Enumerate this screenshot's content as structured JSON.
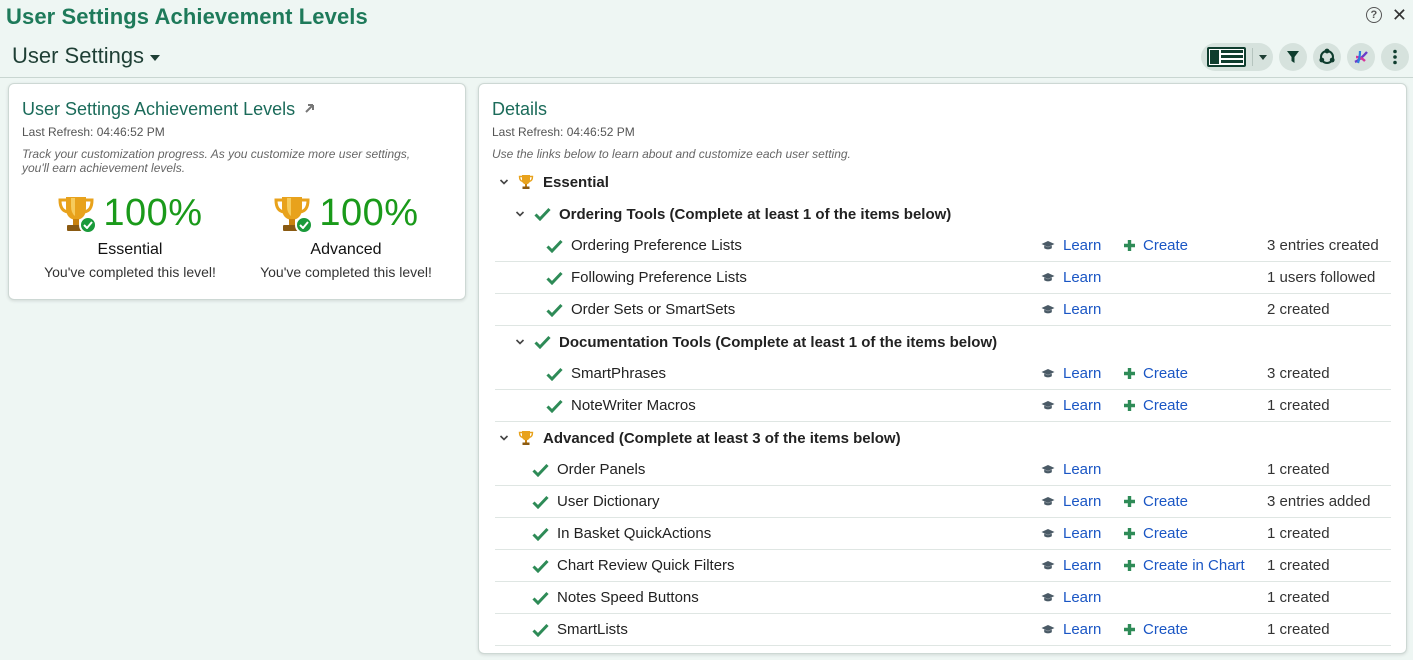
{
  "app": {
    "title": "User Settings Achievement Levels",
    "help_label": "?",
    "close_label": "✕"
  },
  "toolbar": {
    "view_label": "User Settings"
  },
  "summary": {
    "title": "User Settings Achievement Levels",
    "last_refresh": "Last Refresh: 04:46:52 PM",
    "hint_line1": "Track your customization progress. As you customize more user settings,",
    "hint_line2": "you'll earn achievement levels.",
    "levels": [
      {
        "percent": "100%",
        "name": "Essential",
        "message": "You've completed this level!"
      },
      {
        "percent": "100%",
        "name": "Advanced",
        "message": "You've completed this level!"
      }
    ]
  },
  "details": {
    "title": "Details",
    "last_refresh": "Last Refresh: 04:46:52 PM",
    "hint": "Use the links below to learn about and customize each user setting.",
    "learn_label": "Learn",
    "essential_label": "Essential",
    "ordering_group": "Ordering Tools (Complete at least 1 of the items below)",
    "ordering_items": [
      {
        "label": "Ordering Preference Lists",
        "create": "Create",
        "status": "3 entries created"
      },
      {
        "label": "Following Preference Lists",
        "create": "",
        "status": "1 users followed"
      },
      {
        "label": "Order Sets or SmartSets",
        "create": "",
        "status": "2 created"
      }
    ],
    "documentation_group": "Documentation Tools (Complete at least 1 of the items below)",
    "documentation_items": [
      {
        "label": "SmartPhrases",
        "create": "Create",
        "status": "3 created"
      },
      {
        "label": "NoteWriter Macros",
        "create": "Create",
        "status": "1 created"
      }
    ],
    "advanced_label": "Advanced (Complete at least 3 of the items below)",
    "advanced_items": [
      {
        "label": "Order Panels",
        "create": "",
        "status": "1 created"
      },
      {
        "label": "User Dictionary",
        "create": "Create",
        "status": "3 entries added"
      },
      {
        "label": "In Basket QuickActions",
        "create": "Create",
        "status": "1 created"
      },
      {
        "label": "Chart Review Quick Filters",
        "create": "Create in Chart",
        "status": "1 created"
      },
      {
        "label": "Notes Speed Buttons",
        "create": "",
        "status": "1 created"
      },
      {
        "label": "SmartLists",
        "create": "Create",
        "status": "1 created"
      }
    ]
  },
  "colors": {
    "accent": "#1e7a5a",
    "link": "#1a56c4",
    "check": "#2e8b57",
    "percent": "#1a9a1a"
  }
}
